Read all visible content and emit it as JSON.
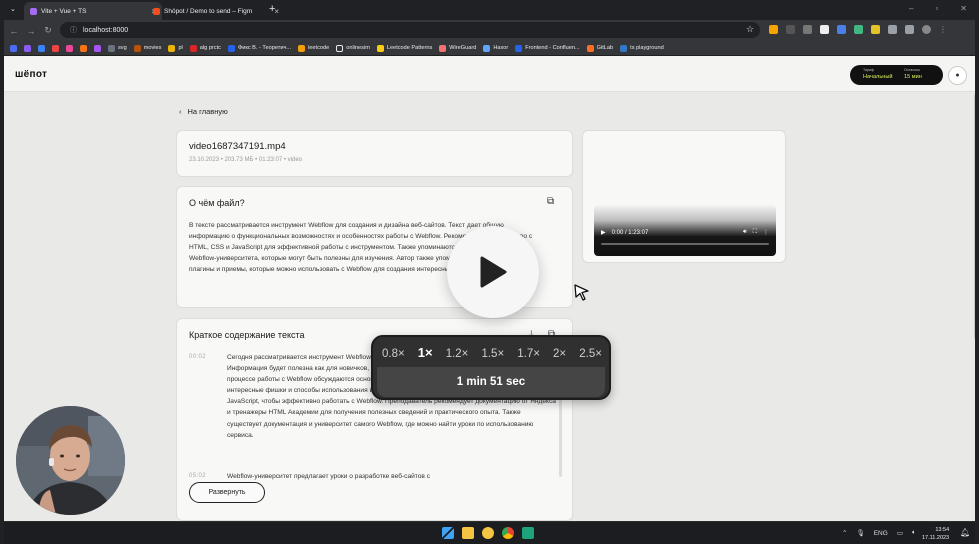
{
  "browser": {
    "tabs": [
      {
        "title": "Vite + Vue + TS",
        "active": true
      },
      {
        "title": "Shöpot / Demo to send – Figm",
        "active": false
      }
    ],
    "url": "localhost:8000",
    "bookmarks": [
      "svg",
      "movies",
      "pl",
      "alg prctc",
      "Фикс В. - Теоретич...",
      "leetcode",
      "onlinesim",
      "Leetcode Patterns",
      "WireGuard",
      "Haxor",
      "Frontend - Confluen...",
      "GitLab",
      "ts playground"
    ]
  },
  "app": {
    "logo": "шёпот",
    "plan": {
      "tariff_label": "Тариф",
      "tariff_value": "Начальный",
      "left_label": "Осталось",
      "left_value": "15 мин"
    }
  },
  "page": {
    "back_label": "На главную",
    "file": {
      "name": "video1687347191.mp4",
      "meta": "23.10.2023  •  203.73 МБ  •  01:23:07  •  video"
    },
    "about": {
      "title": "О чём файл?",
      "text": "В тексте рассматривается инструмент Webflow для создания и дизайна веб-сайтов. Текст дает общую информацию о функциональных возможностях и особенностях работы с Webflow. Рекомендуется знакомство с HTML, CSS и JavaScript для эффективной работы с инструментом. Также упоминаются документация и уроки Webflow-университета, которые могут быть полезны для изучения. Автор также упоминает другие инструменты, плагины и приемы, которые можно использовать с Webflow для создания интересных эффектов и анимаций."
    },
    "summary": {
      "title": "Краткое содержание текста",
      "items": [
        {
          "time": "00:02",
          "text": "Сегодня рассматривается инструмент Webflow, который используется для создания и дизайна веб-сайтов. Информация будет полезна как для новичков, так и для тех, кто уже знаком с этим инструментом. В процессе работы с Webflow обсуждаются основы и функциональные возможности, а также различные интересные фишки и способы использования в проекте. Рекомендуется знакомство с HTML, CSS и JavaScript, чтобы эффективно работать с Webflow. Преподаватель рекомендует документацию от Яндекса и тренажеры HTML Академии для получения полезных сведений и практического опыта. Также существует документация и университет самого Webflow, где можно найти уроки по использованию сервиса."
        },
        {
          "time": "05:02",
          "text": "Webflow-университет предлагает уроки о разработке веб-сайтов с"
        }
      ],
      "expand_label": "Развернуть"
    },
    "video": {
      "time": "0:00 / 1:23:07"
    }
  },
  "overlay": {
    "speeds": [
      "0.8×",
      "1×",
      "1.2×",
      "1.5×",
      "1.7×",
      "2×",
      "2.5×"
    ],
    "selected_speed": "1×",
    "duration": "1 min 51 sec"
  },
  "taskbar": {
    "lang": "ENG",
    "time": "13:54",
    "date": "17.11.2023"
  }
}
